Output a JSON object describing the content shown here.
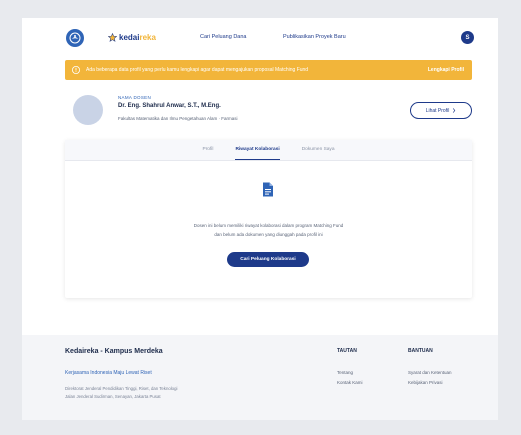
{
  "header": {
    "logo_icon": "tut-wuri-handayani-logo",
    "brand_icon": "star-icon",
    "brand_primary": "kedai",
    "brand_secondary": "reka",
    "nav": [
      {
        "label": "Cari Peluang Dana"
      },
      {
        "label": "Publikasikan Proyek Baru"
      }
    ],
    "user_initial": "S"
  },
  "banner": {
    "icon": "warning-icon",
    "message": "Ada beberapa data profil yang perlu kamu lengkapi agar dapat mengajukan proposal Matching Fund",
    "action": "Lengkapi Profil"
  },
  "profile": {
    "label": "NAMA DOSEN",
    "name": "Dr. Eng. Shahrul Anwar, S.T., M.Eng.",
    "affiliation": "Fakultas Matematika dan Ilmu Pengetahuan Alam · Farmasi",
    "action": "Lihat Profil",
    "action_icon": "chevron-right-icon"
  },
  "tabs": [
    {
      "label": "Profil",
      "active": false
    },
    {
      "label": "Riwayat Kolaborasi",
      "active": true
    },
    {
      "label": "Dokumen Saya",
      "active": false
    }
  ],
  "empty_state": {
    "icon": "document-icon",
    "line1": "Dosen ini belum memiliki riwayat kolaborasi dalam program Matching Fund",
    "line2": "dan belum ada dokumen yang diunggah pada profil ini",
    "action": "Cari Peluang Kolaborasi"
  },
  "footer": {
    "title": "Kedaireka - Kampus Merdeka",
    "tagline": "Kerjasama Indonesia Maju Lewat Riset",
    "address_line1": "Direktorat Jenderal Pendidikan Tinggi, Riset, dan Teknologi",
    "address_line2": "Jalan Jenderal Sudirman, Senayan, Jakarta Pusat",
    "columns": [
      {
        "heading": "TAUTAN",
        "links": [
          "Tentang",
          "Kontak Kami"
        ]
      },
      {
        "heading": "BANTUAN",
        "links": [
          "Syarat dan Ketentuan",
          "Kebijakan Privasi"
        ]
      }
    ]
  },
  "colors": {
    "primary": "#1e3a8a",
    "logo": "#2f64b6",
    "banner": "#f2b53a",
    "footer_bg": "#f4f5f8"
  }
}
